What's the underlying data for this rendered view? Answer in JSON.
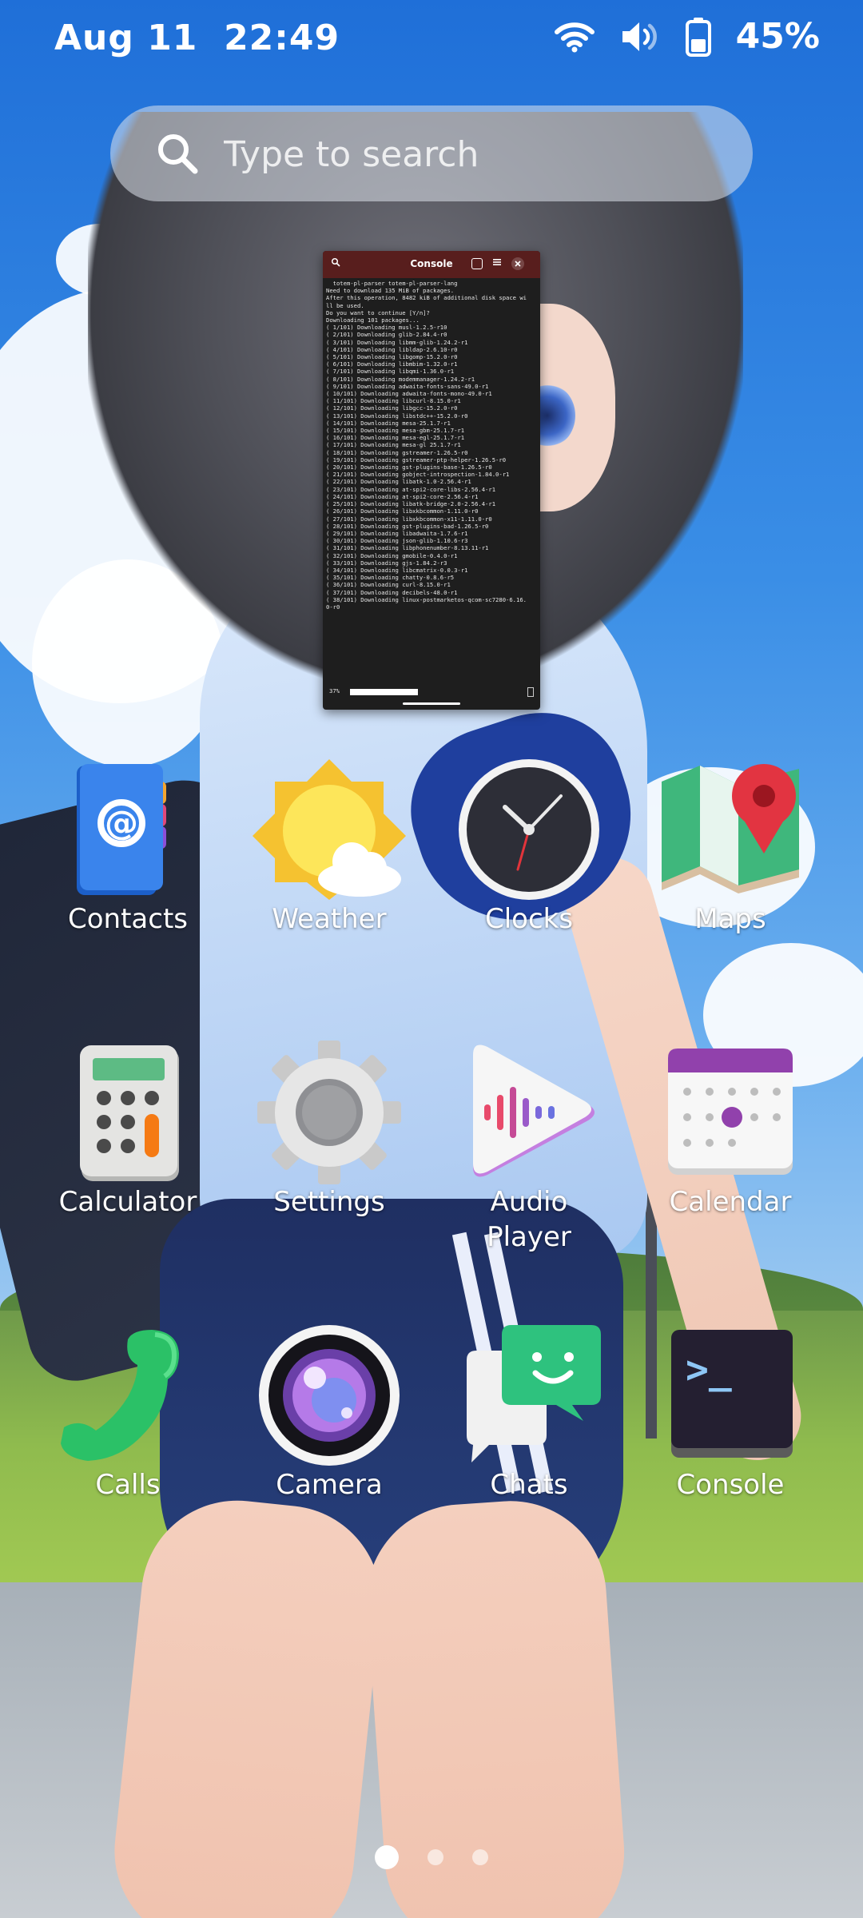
{
  "status_bar": {
    "date": "Aug 11",
    "time": "22:49",
    "battery_percent": "45%",
    "icons": [
      "wifi-icon",
      "volume-icon",
      "battery-icon"
    ]
  },
  "search": {
    "placeholder": "Type to search"
  },
  "console_window": {
    "title": "Console",
    "lines": [
      "  totem-pl-parser totem-pl-parser-lang",
      "Need to download 135 MiB of packages.",
      "After this operation, 8482 kiB of additional disk space wi",
      "ll be used.",
      "Do you want to continue [Y/n]?",
      "Downloading 101 packages...",
      "( 1/101) Downloading musl-1.2.5-r10",
      "( 2/101) Downloading glib-2.84.4-r0",
      "( 3/101) Downloading libmm-glib-1.24.2-r1",
      "( 4/101) Downloading libldap-2.6.10-r0",
      "( 5/101) Downloading libgomp-15.2.0-r0",
      "( 6/101) Downloading libmbim-1.32.0-r1",
      "( 7/101) Downloading libqmi-1.36.0-r1",
      "( 8/101) Downloading modemmanager-1.24.2-r1",
      "( 9/101) Downloading adwaita-fonts-sans-49.0-r1",
      "( 10/101) Downloading adwaita-fonts-mono-49.0-r1",
      "( 11/101) Downloading libcurl-8.15.0-r1",
      "( 12/101) Downloading libgcc-15.2.0-r0",
      "( 13/101) Downloading libstdc++-15.2.0-r0",
      "( 14/101) Downloading mesa-25.1.7-r1",
      "( 15/101) Downloading mesa-gbm-25.1.7-r1",
      "( 16/101) Downloading mesa-egl-25.1.7-r1",
      "( 17/101) Downloading mesa-gl 25.1.7-r1",
      "( 18/101) Downloading gstreamer-1.26.5-r0",
      "( 19/101) Downloading gstreamer-ptp-helper-1.26.5-r0",
      "( 20/101) Downloading gst-plugins-base-1.26.5-r0",
      "( 21/101) Downloading gobject-introspection-1.84.0-r1",
      "( 22/101) Downloading libatk-1.0-2.56.4-r1",
      "( 23/101) Downloading at-spi2-core-libs-2.56.4-r1",
      "( 24/101) Downloading at-spi2-core-2.56.4-r1",
      "( 25/101) Downloading libatk-bridge-2.0-2.56.4-r1",
      "( 26/101) Downloading libxkbcommon-1.11.0-r0",
      "( 27/101) Downloading libxkbcommon-x11-1.11.0-r0",
      "( 28/101) Downloading gst-plugins-bad-1.26.5-r0",
      "( 29/101) Downloading libadwaita-1.7.6-r1",
      "( 30/101) Downloading json-glib-1.10.6-r3",
      "( 31/101) Downloading libphonenumber-8.13.11-r1",
      "( 32/101) Downloading gmobile-0.4.0-r1",
      "( 33/101) Downloading gjs-1.84.2-r3",
      "( 34/101) Downloading libcmatrix-0.0.3-r1",
      "( 35/101) Downloading chatty-0.8.6-r5",
      "( 36/101) Downloading curl-8.15.0-r1",
      "( 37/101) Downloading decibels-48.0-r1",
      "( 38/101) Downloading linux-postmarketos-qcom-sc7280-6.16.",
      "0-r0"
    ],
    "progress_text": "37%",
    "progress": 0.37
  },
  "apps": [
    {
      "label": "Contacts",
      "icon": "contacts-icon"
    },
    {
      "label": "Weather",
      "icon": "weather-icon"
    },
    {
      "label": "Clocks",
      "icon": "clocks-icon"
    },
    {
      "label": "Maps",
      "icon": "maps-icon"
    },
    {
      "label": "Calculator",
      "icon": "calculator-icon"
    },
    {
      "label": "Settings",
      "icon": "settings-icon"
    },
    {
      "label": "Audio Player",
      "icon": "audio-player-icon"
    },
    {
      "label": "Calendar",
      "icon": "calendar-icon"
    },
    {
      "label": "Calls",
      "icon": "calls-icon"
    },
    {
      "label": "Camera",
      "icon": "camera-icon"
    },
    {
      "label": "Chats",
      "icon": "chats-icon"
    },
    {
      "label": "Console",
      "icon": "console-icon"
    }
  ],
  "pager": {
    "pages": 3,
    "active_page": 1
  },
  "colors": {
    "console_header": "#581e1d",
    "console_bg": "#1e1e1e",
    "sky": "#3a8ee6"
  }
}
